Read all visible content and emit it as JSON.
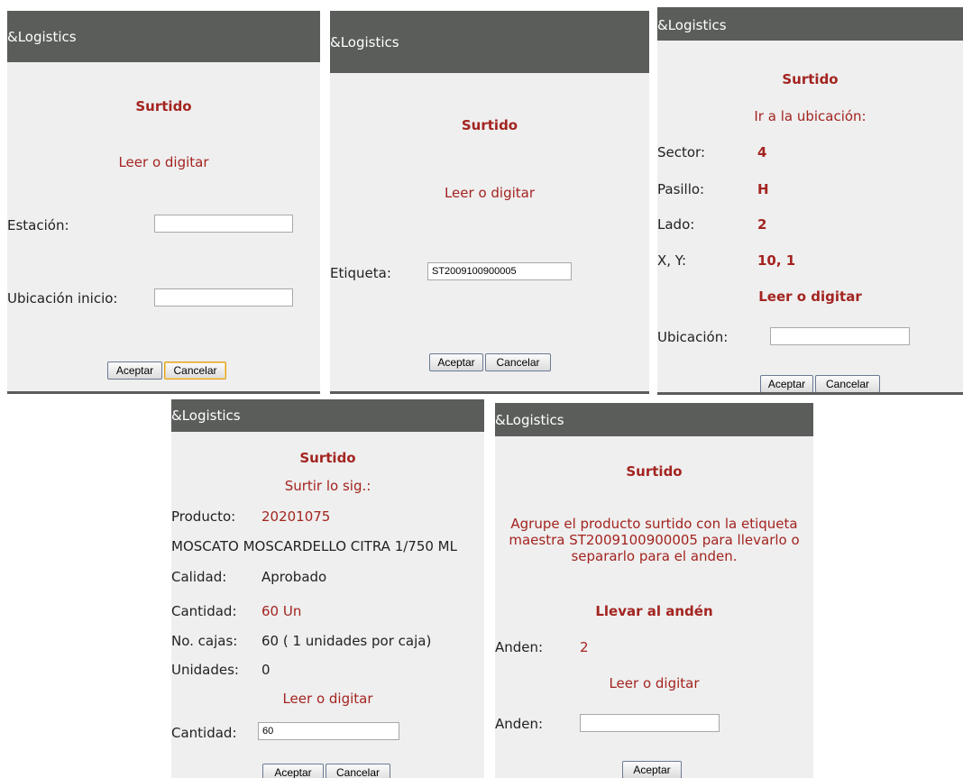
{
  "app_title": "&Logistics",
  "screen_title": "Surtido",
  "screen1": {
    "prompt": "Leer o digitar",
    "estacion_label": "Estación:",
    "estacion_value": "",
    "ubicacion_inicio_label": "Ubicación inicio:",
    "ubicacion_inicio_value": "",
    "accept": "Aceptar",
    "cancel": "Cancelar"
  },
  "screen2": {
    "prompt": "Leer o digitar",
    "etiqueta_label": "Etiqueta:",
    "etiqueta_value": "ST2009100900005",
    "accept": "Aceptar",
    "cancel": "Cancelar"
  },
  "screen3": {
    "subtitle": "Ir a la ubicación:",
    "sector_label": "Sector:",
    "sector_value": "4",
    "pasillo_label": "Pasillo:",
    "pasillo_value": "H",
    "lado_label": "Lado:",
    "lado_value": "2",
    "xy_label": "X, Y:",
    "xy_value": "10, 1",
    "prompt": "Leer o digitar",
    "ubicacion_label": "Ubicación:",
    "ubicacion_value": "",
    "accept": "Aceptar",
    "cancel": "Cancelar"
  },
  "screen4": {
    "subtitle": "Surtir lo sig.:",
    "producto_label": "Producto:",
    "producto_value": "20201075",
    "product_description": "MOSCATO MOSCARDELLO CITRA 1/750 ML",
    "calidad_label": "Calidad:",
    "calidad_value": "Aprobado",
    "cantidad_label": "Cantidad:",
    "cantidad_value": "60 Un",
    "cajas_label": "No. cajas:",
    "cajas_value": "60 ( 1 unidades por caja)",
    "unidades_label": "Unidades:",
    "unidades_value": "0",
    "prompt": "Leer o digitar",
    "cantidad_input_label": "Cantidad:",
    "cantidad_input_value": "60",
    "accept": "Aceptar",
    "cancel": "Cancelar"
  },
  "screen5": {
    "message": "Agrupe el producto surtido con la etiqueta maestra ST2009100900005 para llevarlo o separarlo para el anden.",
    "message_line1": "Agrupe el producto surtido con la etiqueta",
    "message_line2": "maestra ST2009100900005 para llevarlo o",
    "message_line3": "separarlo para el anden.",
    "llevar_title": "Llevar al andén",
    "anden_label": "Anden:",
    "anden_value": "2",
    "prompt": "Leer o digitar",
    "anden_input_label": "Anden:",
    "anden_input_value": "",
    "accept": "Aceptar"
  }
}
